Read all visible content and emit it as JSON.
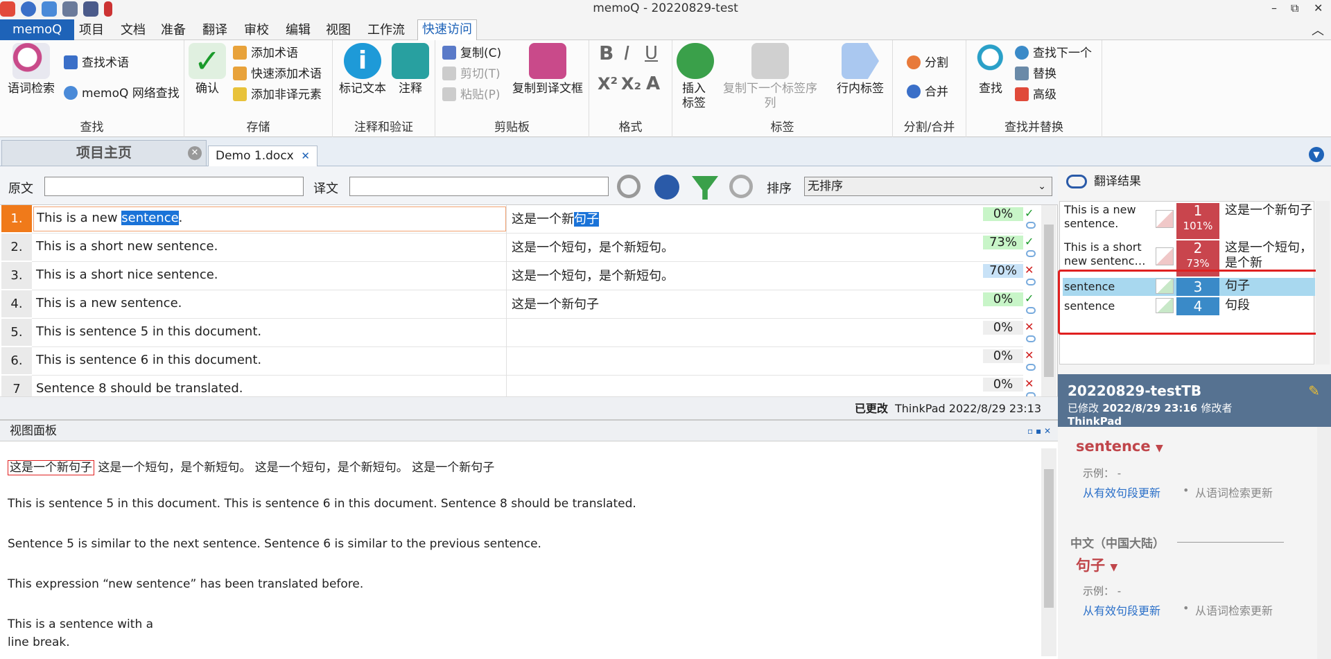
{
  "window": {
    "title": "memoQ - 20220829-test",
    "min": "–",
    "restore": "⧉",
    "close": "✕",
    "collapse": "︿"
  },
  "menu": {
    "app": "memoQ",
    "items": [
      "项目",
      "文档",
      "准备",
      "翻译",
      "审校",
      "编辑",
      "视图",
      "工作流"
    ],
    "active": "快速访问"
  },
  "ribbon": {
    "find": {
      "label": "查找",
      "lookup": "语词检索",
      "find_terms": "查找术语",
      "web_search": "memoQ 网络查找"
    },
    "store": {
      "label": "存储",
      "confirm": "确认",
      "add_term": "添加术语",
      "quick_add_term": "快速添加术语",
      "add_nontrans": "添加非译元素"
    },
    "annot": {
      "label": "注释和验证",
      "mark_text": "标记文本",
      "comment": "注释"
    },
    "clip": {
      "label": "剪贴板",
      "copy": "复制(C)",
      "cut": "剪切(T)",
      "paste": "粘贴(P)",
      "copy_to_target": "复制到译文框"
    },
    "format": {
      "label": "格式",
      "b": "B",
      "i": "I",
      "u": "U",
      "sup": "X²",
      "sub": "X₂",
      "a": "A"
    },
    "tags": {
      "label": "标签",
      "insert": "插入\n标签",
      "copy_next": "复制下一个标签序列",
      "inline": "行内标签"
    },
    "split": {
      "label": "分割/合并",
      "split": "分割",
      "join": "合并"
    },
    "search": {
      "label": "查找并替换",
      "find": "查找",
      "find_next": "查找下一个",
      "replace": "替换",
      "advanced": "高级"
    }
  },
  "tabs": {
    "home": "项目主页",
    "doc": "Demo 1.docx"
  },
  "filter": {
    "source_label": "原文",
    "target_label": "译文",
    "sort_label": "排序",
    "sort_value": "无排序"
  },
  "rows": [
    {
      "n": "1.",
      "src_pre": "This is a new ",
      "src_hl": "sentence",
      "src_post": ".",
      "tgt_pre": "这是一个新",
      "tgt_hl": "句子",
      "pct": "0%",
      "pct_color": "#c8f5c8",
      "status": "✓",
      "status_color": "#1a9a2a"
    },
    {
      "n": "2.",
      "src": "This is a short new sentence.",
      "tgt": "这是一个短句，是个新短句。",
      "pct": "73%",
      "pct_color": "#c8f5c8",
      "status": "✓",
      "status_color": "#1a9a2a"
    },
    {
      "n": "3.",
      "src": "This is a short nice sentence.",
      "tgt": "这是一个短句，是个新短句。",
      "pct": "70%",
      "pct_color": "#c8e2f7",
      "status": "✕",
      "status_color": "#d02020"
    },
    {
      "n": "4.",
      "src": "This is a new sentence.",
      "tgt": "这是一个新句子",
      "pct": "0%",
      "pct_color": "#c8f5c8",
      "status": "✓",
      "status_color": "#1a9a2a"
    },
    {
      "n": "5.",
      "src": "This is sentence 5 in this document.",
      "tgt": "",
      "pct": "0%",
      "pct_color": "#eeeeee",
      "status": "✕",
      "status_color": "#d02020"
    },
    {
      "n": "6.",
      "src": "This is sentence 6 in this document.",
      "tgt": "",
      "pct": "0%",
      "pct_color": "#eeeeee",
      "status": "✕",
      "status_color": "#d02020"
    },
    {
      "n": "7",
      "src": "Sentence 8 should be translated.",
      "tgt": "",
      "pct": "0%",
      "pct_color": "#eeeeee",
      "status": "✕",
      "status_color": "#d02020"
    }
  ],
  "status": {
    "changed": "已更改",
    "info": "ThinkPad 2022/8/29 23:13"
  },
  "viewpanel": {
    "title": "视图面板",
    "boxed": "这是一个新句子",
    "line1_rest": "这是一个短句，是个新短句。 这是一个短句，是个新短句。 这是一个新句子",
    "line2": "This is sentence 5 in this document. This is sentence 6 in this document. Sentence 8 should be translated.",
    "line3": "Sentence 5 is similar to the next sentence. Sentence 6 is similar to the previous sentence.",
    "line4": "This expression “new sentence” has been translated before.",
    "line5": "This is a sentence with a",
    "line6": "line break."
  },
  "results": {
    "title": "翻译结果",
    "items": [
      {
        "src": "This is a new sentence.",
        "num": "1",
        "pct": "101%",
        "tgt": "这是一个新句子",
        "color": "#c9454d"
      },
      {
        "src": "This is a short new sentenc…",
        "num": "2",
        "pct": "73%",
        "tgt": "这是一个短句，是个新",
        "color": "#c9454d"
      },
      {
        "src": "sentence",
        "num": "3",
        "pct": "",
        "tgt": "句子",
        "color": "#3a8ac8"
      },
      {
        "src": "sentence",
        "num": "4",
        "pct": "",
        "tgt": "句段",
        "color": "#3a8ac8"
      }
    ]
  },
  "termbase": {
    "name": "20220829-testTB",
    "modified_label": "已修改",
    "modified_date": "2022/8/29 23:16",
    "modifier_label": "修改者",
    "modifier": "ThinkPad",
    "en_term": "sentence",
    "example_label": "示例：",
    "example_val": "-",
    "link1": "从有效句段更新",
    "link2": "从语词检索更新",
    "lang": "中文（中国大陆）",
    "zh_term": "句子",
    "dot": "•"
  },
  "colors": {
    "accent": "#1e63b8",
    "highlight": "#1a73d8",
    "red": "#e02020"
  }
}
